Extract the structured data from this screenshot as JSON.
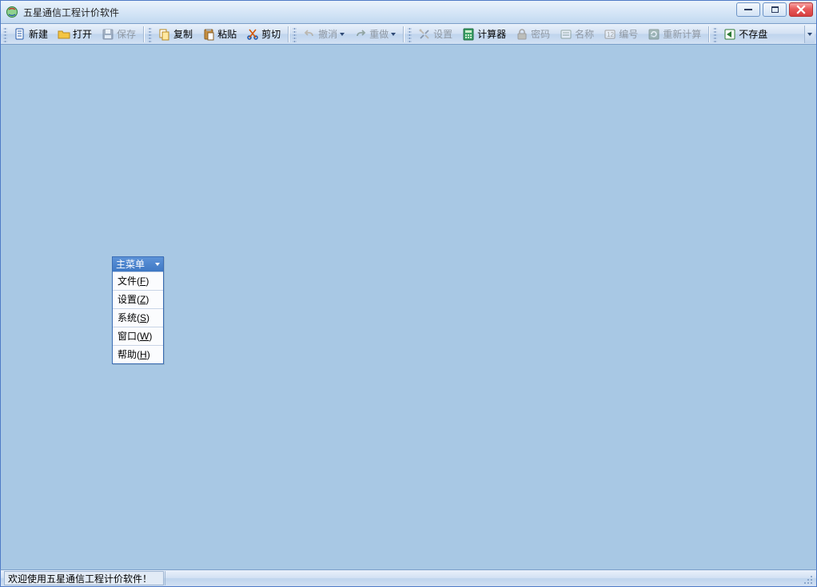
{
  "window": {
    "title": "五星通信工程计价软件"
  },
  "toolbar": {
    "new": "新建",
    "open": "打开",
    "save": "保存",
    "copy": "复制",
    "paste": "粘贴",
    "cut": "剪切",
    "undo": "撤消",
    "redo": "重做",
    "settings": "设置",
    "calculator": "计算器",
    "password": "密码",
    "name": "名称",
    "number": "编号",
    "recalc": "重新计算",
    "nosave": "不存盘"
  },
  "popup": {
    "title": "主菜单",
    "items": [
      {
        "label": "文件",
        "key": "F"
      },
      {
        "label": "设置",
        "key": "Z"
      },
      {
        "label": "系统",
        "key": "S"
      },
      {
        "label": "窗口",
        "key": "W"
      },
      {
        "label": "帮助",
        "key": "H"
      }
    ]
  },
  "statusbar": {
    "message": "欢迎使用五星通信工程计价软件！"
  }
}
